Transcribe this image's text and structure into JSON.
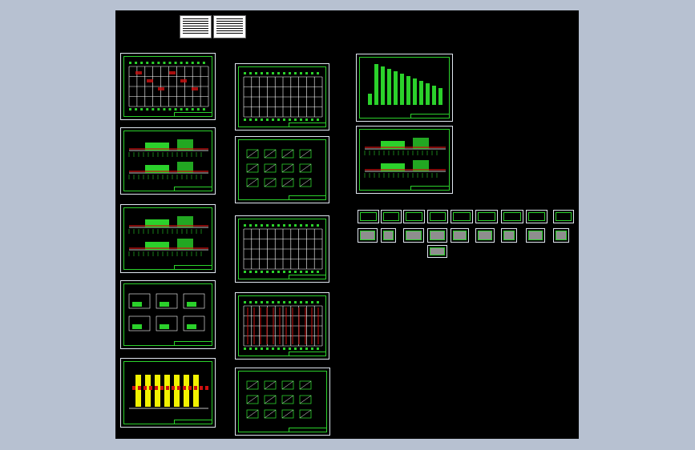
{
  "viewport": {
    "background": "#b7c1d1"
  },
  "drawing": {
    "background": "#000000",
    "accent": "#2bd12b",
    "frame_color": "#dfe6ef",
    "highlight_yellow": "#f2f200",
    "highlight_red": "#d01010"
  },
  "cover_sheets": [
    {
      "name": "drawing-index-sheet"
    },
    {
      "name": "design-notes-sheet"
    }
  ],
  "sheets": [
    {
      "name": "floor-plan-sheet",
      "kind": "plan"
    },
    {
      "name": "elevation-sheet-a",
      "kind": "elevation"
    },
    {
      "name": "elevation-sheet-b",
      "kind": "elevation"
    },
    {
      "name": "section-details-sheet",
      "kind": "sections"
    },
    {
      "name": "elevation-yellow-sheet",
      "kind": "yellow"
    },
    {
      "name": "structural-plan-sheet",
      "kind": "plan-white"
    },
    {
      "name": "foundation-details-sheet",
      "kind": "details"
    },
    {
      "name": "beam-layout-sheet",
      "kind": "plan-white"
    },
    {
      "name": "slab-reinforcement-sheet",
      "kind": "plan-red"
    },
    {
      "name": "stair-details-sheet",
      "kind": "details"
    },
    {
      "name": "column-schedule-sheet",
      "kind": "bars"
    },
    {
      "name": "column-elevation-sheet",
      "kind": "elevation"
    }
  ],
  "thumbnail_rows": [
    {
      "row": 1,
      "count": 9
    },
    {
      "row": 2,
      "count": 9
    },
    {
      "row": 3,
      "count": 1
    }
  ]
}
